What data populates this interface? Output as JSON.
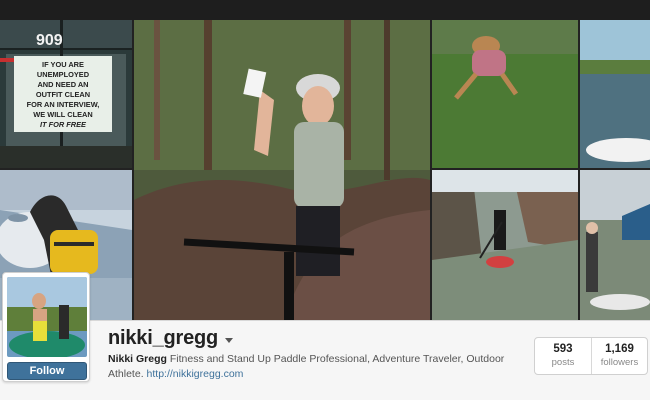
{
  "profile": {
    "username": "nikki_gregg",
    "full_name": "Nikki Gregg",
    "bio": "Fitness and Stand Up Paddle Professional, Adventure Traveler, Outdoor Athlete.",
    "website": "http://nikkigregg.com",
    "follow_label": "Follow"
  },
  "stats": {
    "posts_count": "593",
    "posts_label": "posts",
    "followers_count": "1,169",
    "followers_label": "followers"
  },
  "photos": {
    "sign_number": "909",
    "sign_lines": [
      "IF YOU ARE",
      "UNEMPLOYED",
      "AND NEED AN",
      "OUTFIT CLEAN",
      "FOR AN INTERVIEW,",
      "WE WILL CLEAN",
      "IT FOR FREE"
    ]
  },
  "colors": {
    "follow_button": "#3f729b",
    "link": "#3f729b",
    "topbar": "#1e1e1e"
  }
}
